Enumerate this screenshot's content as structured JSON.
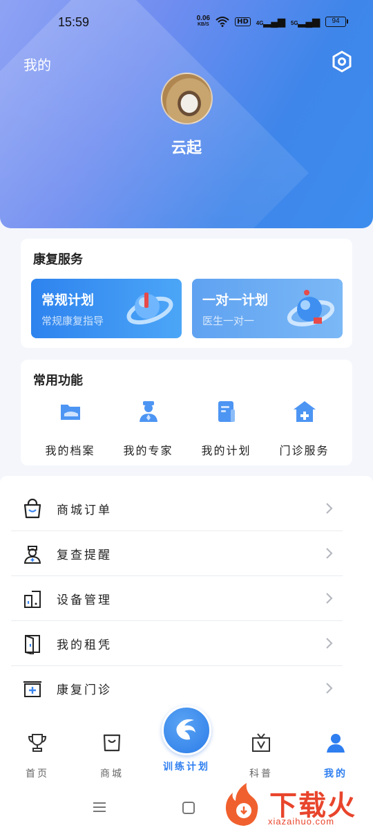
{
  "status_bar": {
    "time": "15:59",
    "speed_value": "0.06",
    "speed_unit": "KB/S",
    "hd_label": "HD",
    "net_1": "4G",
    "net_2": "5G",
    "battery": "94",
    "icons": [
      "wifi-icon",
      "signal-icon",
      "battery-icon"
    ]
  },
  "header": {
    "title": "我的",
    "username": "云起",
    "settings_icon": "settings-hexagon-icon"
  },
  "rehab_services": {
    "title": "康复服务",
    "items": [
      {
        "title": "常规计划",
        "subtitle": "常规康复指导",
        "icon": "planet-ring-icon"
      },
      {
        "title": "一对一计划",
        "subtitle": "医生一对一",
        "icon": "orb-ring-icon"
      }
    ]
  },
  "common_functions": {
    "title": "常用功能",
    "items": [
      {
        "label": "我的档案",
        "icon": "folder-icon"
      },
      {
        "label": "我的专家",
        "icon": "doctor-icon"
      },
      {
        "label": "我的计划",
        "icon": "document-icon"
      },
      {
        "label": "门诊服务",
        "icon": "clinic-icon"
      }
    ]
  },
  "menu": {
    "items": [
      {
        "label": "商城订单",
        "icon": "shopping-bag-icon"
      },
      {
        "label": "复查提醒",
        "icon": "nurse-icon"
      },
      {
        "label": "设备管理",
        "icon": "device-icon"
      },
      {
        "label": "我的租凭",
        "icon": "door-icon"
      },
      {
        "label": "康复门诊",
        "icon": "medical-kit-icon"
      }
    ]
  },
  "tab_bar": {
    "tabs": [
      {
        "label": "首页",
        "icon": "trophy-icon"
      },
      {
        "label": "商城",
        "icon": "bag-icon"
      },
      {
        "label": "训练计划",
        "icon": "logo-icon"
      },
      {
        "label": "科普",
        "icon": "video-icon"
      },
      {
        "label": "我的",
        "icon": "person-icon"
      }
    ],
    "active": "我的",
    "accent": "#2e7ef0"
  },
  "watermark": {
    "text": "下载火",
    "sub": "xiazaihuo.com"
  },
  "colors": {
    "hero_gradient_start": "#8fa3f4",
    "hero_gradient_end": "#3c8cee",
    "accent": "#2e7ef0"
  }
}
